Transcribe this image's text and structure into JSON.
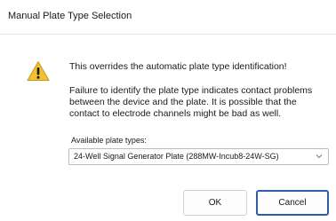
{
  "window": {
    "title": "Manual Plate Type Selection"
  },
  "icons": {
    "warning": "warning-icon",
    "dropdown": "chevron-down-icon"
  },
  "message": {
    "primary": "This overrides the automatic plate type identification!",
    "secondary": "Failure to identify the plate type indicates contact problems between the device and the plate. It is possible that the contact to electrode channels might be bad as well."
  },
  "plate_select": {
    "label": "Available plate types:",
    "selected": "24-Well Signal Generator Plate (288MW-Incub8-24W-SG)"
  },
  "buttons": {
    "ok": "OK",
    "cancel": "Cancel"
  },
  "colors": {
    "warning_fill": "#f2c230",
    "default_button_border": "#2b5fa8"
  }
}
